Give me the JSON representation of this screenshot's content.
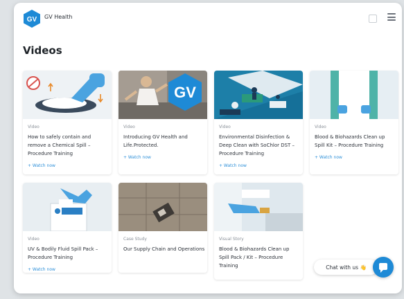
{
  "header": {
    "logo_text": "GV",
    "brand": "GV Health"
  },
  "page_title": "Videos",
  "cards": [
    {
      "kind": "Video",
      "title": "How to safely contain and remove a Chemical Spill – Procedure Training",
      "link": "+ Watch now"
    },
    {
      "kind": "Video",
      "title": "Introducing GV Health and Life.Protected.",
      "link": "+ Watch now"
    },
    {
      "kind": "Video",
      "title": "Environmental Disinfection & Deep Clean with SoChlor DST – Procedure Training",
      "link": "+ Watch now"
    },
    {
      "kind": "Video",
      "title": "Blood & Biohazards Clean up Spill Kit – Procedure Training",
      "link": "+ Watch now"
    },
    {
      "kind": "Video",
      "title": "UV & Bodily Fluid Spill Pack – Procedure Training",
      "link": "+ Watch now"
    },
    {
      "kind": "Case Study",
      "title": "Our Supply Chain and Operations"
    },
    {
      "kind": "Visual Story",
      "title": "Blood & Biohazards Clean up Spill Pack / Kit – Procedure Training"
    }
  ],
  "chat": {
    "label": "Chat with us 👋"
  },
  "colors": {
    "accent": "#1e8ad6",
    "link": "#2d8fd8"
  }
}
